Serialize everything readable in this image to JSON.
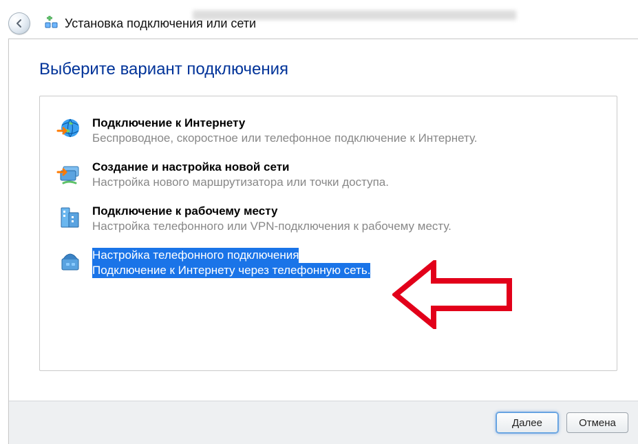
{
  "header": {
    "window_title": "Установка подключения или сети"
  },
  "wizard": {
    "heading": "Выберите вариант подключения",
    "options": {
      "internet": {
        "title": "Подключение к Интернету",
        "subtitle": "Беспроводное, скоростное или телефонное подключение к Интернету.",
        "icon": "globe-connect-icon"
      },
      "new_network": {
        "title": "Создание и настройка новой сети",
        "subtitle": "Настройка нового маршрутизатора или точки доступа.",
        "icon": "router-setup-icon"
      },
      "workplace": {
        "title": "Подключение к рабочему месту",
        "subtitle": "Настройка телефонного или VPN-подключения к рабочему месту.",
        "icon": "workplace-icon"
      },
      "dialup": {
        "title": "Настройка телефонного подключения",
        "subtitle": "Подключение к Интернету через телефонную сеть.",
        "icon": "phone-modem-icon",
        "selected": true
      }
    }
  },
  "buttons": {
    "next_label": "Далее",
    "cancel_label": "Отмена"
  }
}
